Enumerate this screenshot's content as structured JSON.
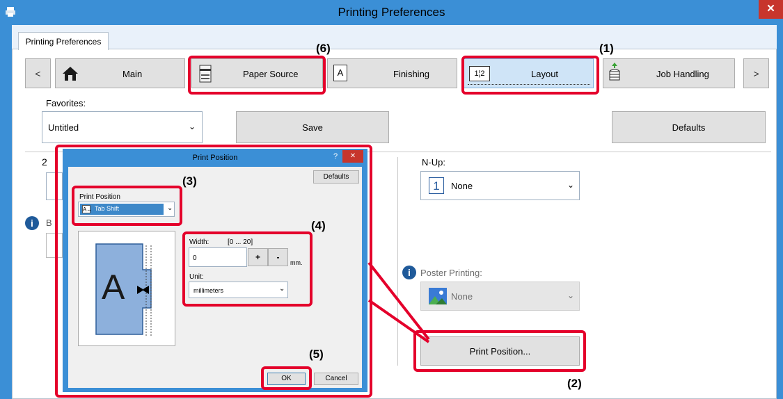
{
  "window": {
    "title": "Printing Preferences",
    "close_glyph": "✕"
  },
  "top_tab": "Printing Preferences",
  "tabs": [
    {
      "label": "Main",
      "icon": "home-icon"
    },
    {
      "label": "Paper Source",
      "icon": "paper-tray-icon"
    },
    {
      "label": "Finishing",
      "icon": "finishing-icon"
    },
    {
      "label": "Layout",
      "icon": "layout-icon"
    },
    {
      "label": "Job Handling",
      "icon": "job-handling-icon"
    }
  ],
  "nav": {
    "prev": "<",
    "next": ">"
  },
  "favorites": {
    "label": "Favorites:",
    "value": "Untitled",
    "save": "Save",
    "defaults": "Defaults"
  },
  "bg_partial": {
    "number": "2",
    "letter": "B"
  },
  "nup": {
    "label": "N-Up:",
    "digit": "1",
    "value": "None"
  },
  "poster": {
    "label": "Poster Printing:",
    "value": "None"
  },
  "print_position_button": "Print Position...",
  "dialog": {
    "title": "Print Position",
    "help": "?",
    "close": "✕",
    "defaults": "Defaults",
    "print_position_label": "Print Position",
    "print_position_value": "Tab Shift",
    "width_label": "Width:",
    "range": "[0 ... 20]",
    "width_value": "0",
    "plus": "+",
    "minus": "-",
    "unit_suffix": "mm.",
    "unit_label": "Unit:",
    "unit_value": "millimeters",
    "preview_letter": "A",
    "ok": "OK",
    "cancel": "Cancel"
  },
  "callouts": {
    "c1": "(1)",
    "c2": "(2)",
    "c3": "(3)",
    "c4": "(4)",
    "c5": "(5)",
    "c6": "(6)"
  },
  "colors": {
    "accent": "#3b8fd6",
    "highlight": "#e4002b",
    "selection": "#3d88c9",
    "close": "#c7352c"
  }
}
